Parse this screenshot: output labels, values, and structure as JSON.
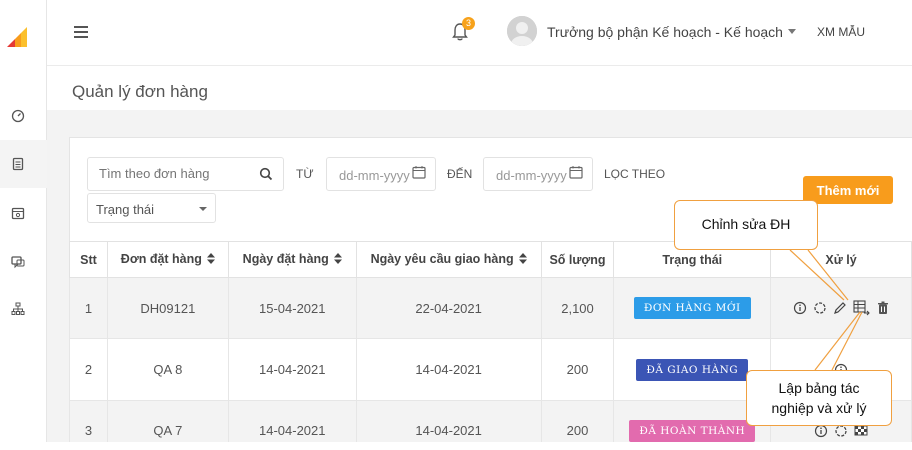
{
  "app": {
    "notification_count": "3",
    "user_name": "Trưởng bộ phận Kế hoạch - Kế hoạch",
    "company": "XM MẪU"
  },
  "page": {
    "title": "Quản lý đơn hàng"
  },
  "filters": {
    "search_placeholder": "Tìm theo đơn hàng",
    "from_label": "TỪ",
    "from_placeholder": "dd-mm-yyyy",
    "to_label": "ĐẾN",
    "to_placeholder": "dd-mm-yyyy",
    "filter_label": "LỌC THEO",
    "status_select": "Trạng thái",
    "add_button": "Thêm mới"
  },
  "table": {
    "headers": [
      "Stt",
      "Đơn đặt hàng",
      "Ngày đặt hàng",
      "Ngày yêu cầu giao hàng",
      "Số lượng",
      "Trạng thái",
      "Xử lý"
    ],
    "rows": [
      {
        "stt": "1",
        "order": "DH09121",
        "order_date": "15-04-2021",
        "delivery_date": "22-04-2021",
        "qty": "2,100",
        "status": "ĐƠN HÀNG MỚI",
        "status_color": "#2c9ce8"
      },
      {
        "stt": "2",
        "order": "QA 8",
        "order_date": "14-04-2021",
        "delivery_date": "14-04-2021",
        "qty": "200",
        "status": "ĐÃ GIAO HÀNG",
        "status_color": "#3b55b5"
      },
      {
        "stt": "3",
        "order": "QA 7",
        "order_date": "14-04-2021",
        "delivery_date": "14-04-2021",
        "qty": "200",
        "status": "ĐÃ HOÀN THÀNH",
        "status_color": "#e26bae"
      }
    ]
  },
  "annotations": {
    "edit_callout": "Chỉnh sửa ĐH",
    "plan_callout_line1": "Lập bảng tác",
    "plan_callout_line2": "nghiệp và xử lý"
  },
  "icons": [
    "logo",
    "dashboard-icon",
    "document-icon",
    "calendar-icon",
    "chat-icon",
    "sitemap-icon",
    "menu-icon",
    "bell-icon",
    "search-icon",
    "calendar-icon",
    "info-icon",
    "refresh-icon",
    "edit-icon",
    "table-process-icon",
    "trash-icon",
    "flag-icon"
  ]
}
